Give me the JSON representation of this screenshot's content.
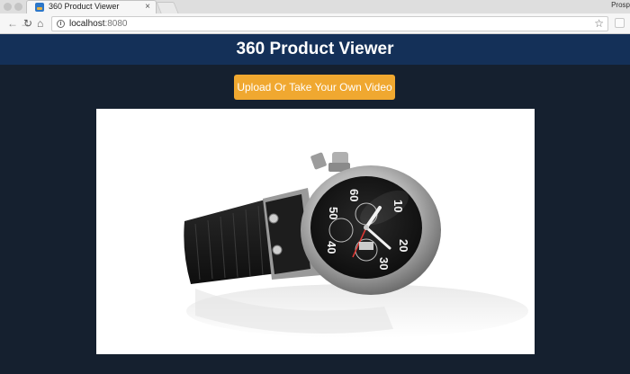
{
  "browser": {
    "tab_title": "360 Product Viewer",
    "tab_close": "×",
    "profile_label": "Prosp",
    "url_host": "localhost",
    "url_port": ":8080",
    "info_glyph": "i",
    "bookmark_glyph": "☆"
  },
  "header": {
    "title": "360 Product Viewer"
  },
  "actions": {
    "upload_label": "Upload Or Take Your Own Video"
  },
  "viewer": {
    "dial_numbers": [
      "60",
      "50",
      "40",
      "30",
      "20",
      "10"
    ]
  },
  "colors": {
    "header_bg": "#143058",
    "page_bg": "#15202f",
    "button_bg": "#f0a830"
  }
}
